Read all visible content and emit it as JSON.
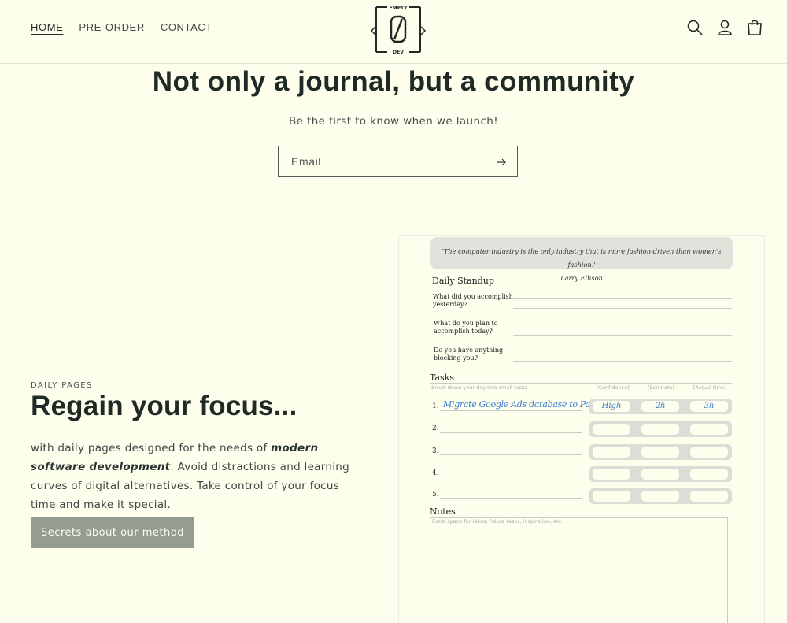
{
  "nav": {
    "items": [
      {
        "label": "HOME"
      },
      {
        "label": "PRE-ORDER"
      },
      {
        "label": "CONTACT"
      }
    ]
  },
  "logo": {
    "top_text": "EMPTY",
    "bottom_text": "DEV",
    "center_glyph": "0"
  },
  "header_icons": [
    "search-icon",
    "account-icon",
    "cart-icon"
  ],
  "newsletter": {
    "title": "Not only a journal, but a community",
    "subtitle": "Be the first to know when we launch!",
    "email_placeholder": "Email"
  },
  "feature": {
    "eyebrow": "DAILY PAGES",
    "title": "Regain your focus...",
    "text_before": "with daily pages designed for the needs of ",
    "text_bold": "modern software development",
    "text_after": ". Avoid distractions and learning curves of digital alternatives. Take control of your focus time and make it special.",
    "cta_label": "Secrets about our method"
  },
  "journal": {
    "quote": "'The computer industry is the only industry that is more fashion-driven than women's fashion.'",
    "quote_author": "Larry Ellison",
    "standup_heading": "Daily Standup",
    "questions": [
      {
        "line1": "What did you accomplish",
        "line2": "yesterday?"
      },
      {
        "line1": "What do you plan to",
        "line2": "accomplish today?"
      },
      {
        "line1": "Do you have anything",
        "line2": "blocking you?"
      }
    ],
    "tasks_heading": "Tasks",
    "tasks_hint": "Break down your day into small tasks",
    "col_confidence": "[Confidence]",
    "col_estimate": "[Estimate]",
    "col_actual": "[Actual time]",
    "task_numbers": [
      "1.",
      "2.",
      "3.",
      "4.",
      "5."
    ],
    "first_task": {
      "text": "Migrate Google Ads database to PaaS",
      "confidence": "High",
      "estimate": "2h",
      "actual": "3h"
    },
    "notes_heading": "Notes",
    "notes_hint": "Extra space for ideas, future tasks, inspiration, etc."
  },
  "colors": {
    "background": "#fdfeeb",
    "button": "#959c91",
    "handwriting": "#3b7ad1"
  }
}
